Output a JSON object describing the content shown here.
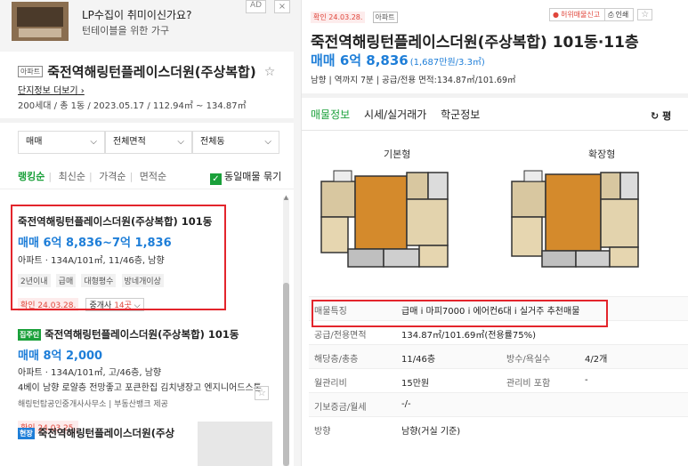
{
  "ad": {
    "title": "LP수집이 취미이신가요?",
    "subtitle": "턴테이블을 위한 가구",
    "badge": "AD",
    "close": "×"
  },
  "complex": {
    "tag": "아파트",
    "name": "죽전역해링턴플레이스더원(주상복합)",
    "more_link": "단지정보 더보기",
    "meta": "200세대 / 총 1동 / 2023.05.17 / 112.94㎡ ~ 134.87㎡"
  },
  "filters": {
    "trade": "매매",
    "area": "전체면적",
    "building": "전체동"
  },
  "sort": {
    "options": [
      "랭킹순",
      "최신순",
      "가격순",
      "면적순"
    ],
    "same_listing": "동일매물 묶기"
  },
  "listings": [
    {
      "name": "죽전역해링턴플레이스더원(주상복합) 101동",
      "price": "매매 6억 8,836~7억 1,836",
      "spec": "아파트 · 134A/101㎡, 11/46층, 남향",
      "chips": [
        "2년이내",
        "급매",
        "대형평수",
        "방네개이상"
      ],
      "confirmed": "확인 24.03.28.",
      "agents_label": "중개사",
      "agents_count": "14곳"
    },
    {
      "tag": "집주인",
      "name": "죽전역해링턴플레이스더원(주상복합) 101동",
      "price": "매매 8억 2,000",
      "spec": "아파트 · 134A/101㎡, 고/46층, 남향",
      "desc": "4베이 남향 로얄층 전망좋고 포큰한집 김치냉장고 엔지니어드스톤",
      "source": "해링턴탑공인중개사사무소 | 부동산뱅크 제공",
      "confirmed": "확인 24.03.25."
    },
    {
      "tag": "현장",
      "name": "죽전역해링턴플레이스더원(주상"
    }
  ],
  "detail": {
    "confirmed": "확인 24.03.28.",
    "type_tag": "아파트",
    "report": "허위매물신고",
    "print": "인쇄",
    "title": "죽전역해링턴플레이스더원(주상복합) 101동·11층",
    "price": "매매 6억 8,836",
    "price_unit": "(1,687만원/3.3㎡)",
    "meta": "남향 | 역까지 7분 | 공급/전용 면적:134.87㎡/101.69㎡",
    "tabs": [
      "매물정보",
      "시세/실거래가",
      "학군정보"
    ],
    "refresh": "평",
    "plans": [
      "기본형",
      "확장형"
    ],
    "info": [
      {
        "k": "매물특징",
        "v": "급매 i 마피7000 i 에어컨6대 i 실거주 추천매물"
      },
      {
        "k": "공급/전용면적",
        "v": "134.87㎡/101.69㎡(전용률75%)"
      },
      {
        "k": "해당층/총층",
        "v": "11/46층",
        "k2": "방수/욕실수",
        "v2": "4/2개"
      },
      {
        "k": "월관리비",
        "v": "15만원",
        "k2": "관리비 포함",
        "v2": "-"
      },
      {
        "k": "기보증금/월세",
        "v": "-/-"
      },
      {
        "k": "방향",
        "v": "남향(거실 기준)"
      }
    ]
  }
}
